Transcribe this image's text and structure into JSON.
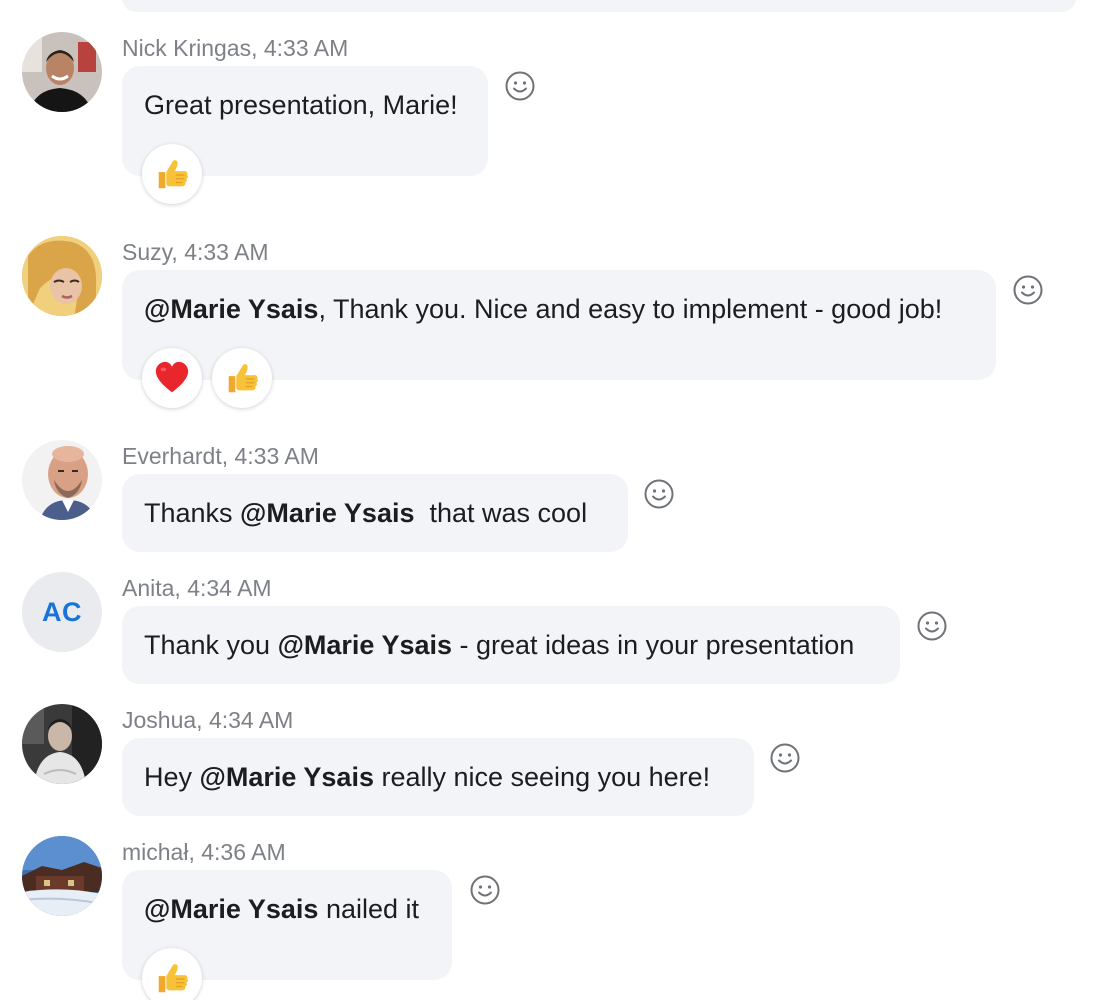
{
  "messages": [
    {
      "author": "Nick Kringas",
      "time": "4:33 AM",
      "meta": "Nick Kringas, 4:33 AM",
      "text_before": "Great presentation, Marie!",
      "reactions": [
        "thumbs-up"
      ]
    },
    {
      "author": "Suzy",
      "time": "4:33 AM",
      "meta": "Suzy, 4:33 AM",
      "mention": "@Marie Ysais",
      "text_after": ", Thank you. Nice and easy to implement - good job!",
      "reactions": [
        "heart",
        "thumbs-up"
      ]
    },
    {
      "author": "Everhardt",
      "time": "4:33 AM",
      "meta": "Everhardt, 4:33 AM",
      "text_before": "Thanks ",
      "mention": "@Marie Ysais",
      "text_after": "  that was cool"
    },
    {
      "author": "Anita",
      "time": "4:34 AM",
      "meta": "Anita, 4:34 AM",
      "avatar_initials": "AC",
      "text_before": "Thank you ",
      "mention": "@Marie Ysais",
      "text_after": " - great ideas in your presentation"
    },
    {
      "author": "Joshua",
      "time": "4:34 AM",
      "meta": "Joshua, 4:34 AM",
      "text_before": "Hey ",
      "mention": "@Marie Ysais",
      "text_after": " really nice seeing you here!"
    },
    {
      "author": "michał",
      "time": "4:36 AM",
      "meta": "michał, 4:36 AM",
      "mention": "@Marie Ysais",
      "text_after": " nailed it",
      "reactions": [
        "thumbs-up"
      ]
    }
  ],
  "colors": {
    "bubble_bg": "#f2f4f7",
    "meta_text": "#7d8187",
    "message_text": "#1c1d1f",
    "initials_text": "#1a73d9",
    "heart": "#e8262c",
    "thumbs_up": "#f7c23a"
  }
}
